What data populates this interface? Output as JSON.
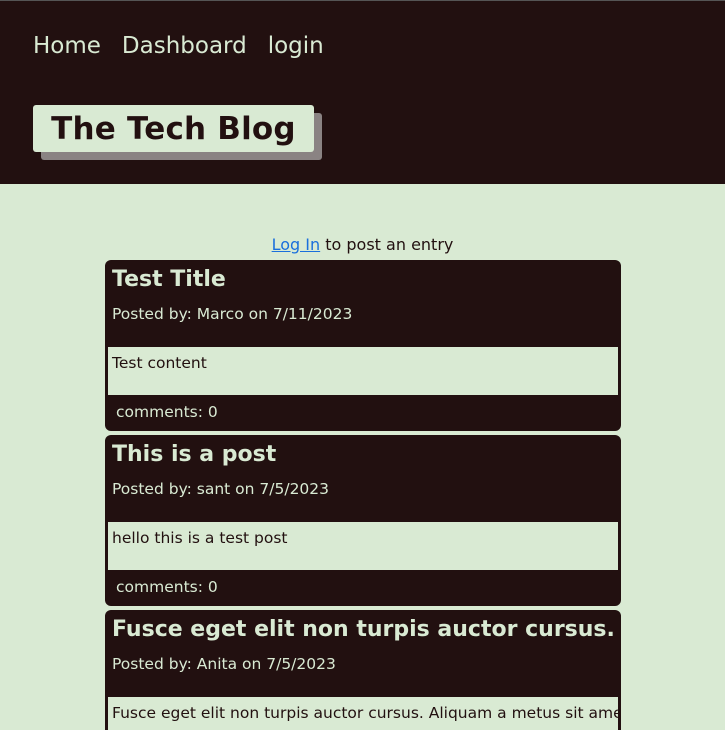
{
  "nav": {
    "home": "Home",
    "dashboard": "Dashboard",
    "login": "login"
  },
  "site": {
    "title": "The Tech Blog"
  },
  "login_hint": {
    "link": "Log In",
    "rest": " to post an entry"
  },
  "posts": [
    {
      "title": "Test Title",
      "meta": "Posted by: Marco on 7/11/2023",
      "content": "Test content",
      "comments": "comments: 0"
    },
    {
      "title": "This is a post",
      "meta": "Posted by: sant on 7/5/2023",
      "content": "hello this is a test post",
      "comments": "comments: 0"
    },
    {
      "title": "Fusce eget elit non turpis auctor cursus.",
      "meta": "Posted by: Anita on 7/5/2023",
      "content": "Fusce eget elit non turpis auctor cursus. Aliquam a metus sit amet ex",
      "comments": ""
    }
  ],
  "colors": {
    "dark": "#221010",
    "light": "#d9ead3",
    "shadow": "#8a8383",
    "link": "#1a6fdc"
  }
}
